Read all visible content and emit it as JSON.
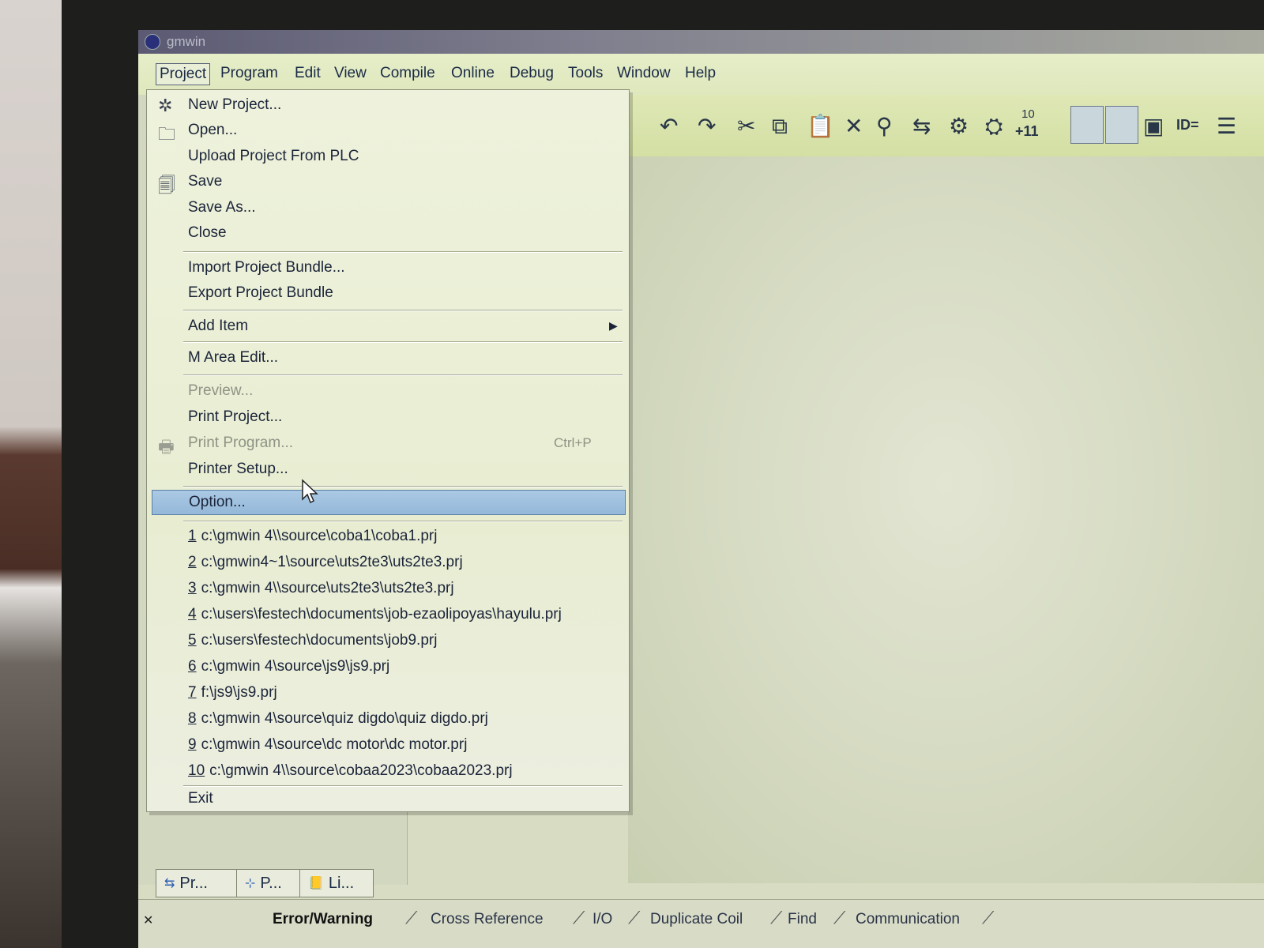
{
  "window": {
    "title": "gmwin"
  },
  "menubar": {
    "items": [
      {
        "label": "Project"
      },
      {
        "label": "Program"
      },
      {
        "label": "Edit"
      },
      {
        "label": "View"
      },
      {
        "label": "Compile"
      },
      {
        "label": "Online"
      },
      {
        "label": "Debug"
      },
      {
        "label": "Tools"
      },
      {
        "label": "Window"
      },
      {
        "label": "Help"
      }
    ]
  },
  "project_menu": {
    "items": [
      {
        "label": "New Project...",
        "icon": "new-project-icon"
      },
      {
        "label": "Open...",
        "icon": "open-folder-icon"
      },
      {
        "label": "Upload Project From PLC"
      },
      {
        "label": "Save",
        "icon": "save-icon"
      },
      {
        "label": "Save As..."
      },
      {
        "label": "Close"
      },
      {
        "label": "Import Project Bundle..."
      },
      {
        "label": "Export Project Bundle"
      },
      {
        "label": "Add Item"
      },
      {
        "label": "M Area Edit..."
      },
      {
        "label": "Preview..."
      },
      {
        "label": "Print Project..."
      },
      {
        "label": "Print Program...",
        "shortcut": "Ctrl+P",
        "icon": "printer-icon"
      },
      {
        "label": "Printer Setup..."
      },
      {
        "label": "Option..."
      }
    ],
    "recent": [
      {
        "num": "1",
        "path": "c:\\gmwin 4\\\\source\\coba1\\coba1.prj"
      },
      {
        "num": "2",
        "path": "c:\\gmwin4~1\\source\\uts2te3\\uts2te3.prj"
      },
      {
        "num": "3",
        "path": "c:\\gmwin 4\\\\source\\uts2te3\\uts2te3.prj"
      },
      {
        "num": "4",
        "path": "c:\\users\\festech\\documents\\job-ezaolipoyas\\hayulu.prj"
      },
      {
        "num": "5",
        "path": "c:\\users\\festech\\documents\\job9.prj"
      },
      {
        "num": "6",
        "path": "c:\\gmwin 4\\source\\js9\\js9.prj"
      },
      {
        "num": "7",
        "path": "f:\\js9\\js9.prj"
      },
      {
        "num": "8",
        "path": "c:\\gmwin 4\\source\\quiz digdo\\quiz digdo.prj"
      },
      {
        "num": "9",
        "path": "c:\\gmwin 4\\source\\dc motor\\dc motor.prj"
      },
      {
        "num": "10",
        "path": "c:\\gmwin 4\\\\source\\cobaa2023\\cobaa2023.prj"
      }
    ],
    "exit": "Exit"
  },
  "toolbar": {
    "icons": [
      "undo-icon",
      "redo-icon",
      "cut-icon",
      "copy-icon",
      "paste-icon",
      "delete-icon",
      "find-icon",
      "replace-icon",
      "network-icon",
      "monitor-icon"
    ],
    "counter_top": "10",
    "counter_bottom": "+11",
    "id_label": "ID="
  },
  "panel_tabs": [
    {
      "label": "Pr..."
    },
    {
      "label": "P..."
    },
    {
      "label": "Li..."
    }
  ],
  "status_tabs": [
    {
      "label": "Error/Warning"
    },
    {
      "label": "Cross Reference"
    },
    {
      "label": "I/O"
    },
    {
      "label": "Duplicate Coil"
    },
    {
      "label": "Find"
    },
    {
      "label": "Communication"
    }
  ]
}
